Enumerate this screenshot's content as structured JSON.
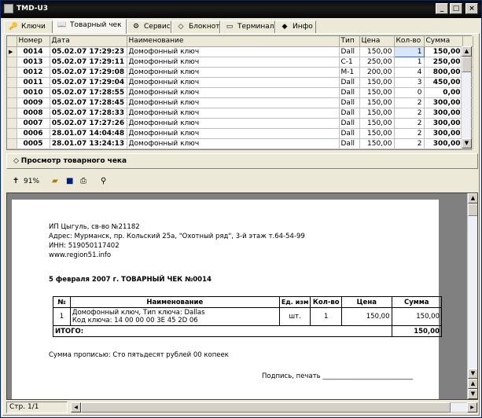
{
  "window": {
    "title": "TMD-U3"
  },
  "tabs": [
    {
      "label": "Ключи",
      "icon": "key-icon"
    },
    {
      "label": "Товарный чек",
      "icon": "book-icon"
    },
    {
      "label": "Сервис",
      "icon": "service-icon"
    },
    {
      "label": "Блокнот",
      "icon": "notepad-icon"
    },
    {
      "label": "Терминал",
      "icon": "terminal-icon"
    },
    {
      "label": "Инфо",
      "icon": "info-icon"
    }
  ],
  "grid": {
    "columns": [
      "Номер",
      "Дата",
      "Наименование",
      "Тип",
      "Цена",
      "Кол-во",
      "Сумма"
    ],
    "rows": [
      [
        "0014",
        "05.02.07 17:29:23",
        "Домофонный ключ",
        "Dall",
        "150,00",
        "1",
        "150,00"
      ],
      [
        "0013",
        "05.02.07 17:29:11",
        "Домофонный ключ",
        "C-1",
        "250,00",
        "1",
        "250,00"
      ],
      [
        "0012",
        "05.02.07 17:29:08",
        "Домофонный ключ",
        "M-1",
        "200,00",
        "4",
        "800,00"
      ],
      [
        "0011",
        "05.02.07 17:29:04",
        "Домофонный ключ",
        "Dall",
        "150,00",
        "3",
        "450,00"
      ],
      [
        "0010",
        "05.02.07 17:28:55",
        "Домофонный ключ",
        "Dall",
        "150,00",
        "0",
        "0,00"
      ],
      [
        "0009",
        "05.02.07 17:28:45",
        "Домофонный ключ",
        "Dall",
        "150,00",
        "2",
        "300,00"
      ],
      [
        "0008",
        "05.02.07 17:28:33",
        "Домофонный ключ",
        "Dall",
        "150,00",
        "2",
        "300,00"
      ],
      [
        "0007",
        "05.02.07 17:27:26",
        "Домофонный ключ",
        "Dall",
        "150,00",
        "2",
        "300,00"
      ],
      [
        "0006",
        "28.01.07 14:04:48",
        "Домофонный ключ",
        "Dall",
        "150,00",
        "2",
        "300,00"
      ],
      [
        "0005",
        "28.01.07 13:24:13",
        "Домофонный ключ",
        "Dall",
        "150,00",
        "2",
        "300,00"
      ]
    ]
  },
  "view_button": "Просмотр товарного чека",
  "toolbar": {
    "zoom": "91%"
  },
  "receipt": {
    "line1": "ИП Цыгуль, св-во №21182",
    "line2": "Адрес: Мурманск, пр. Кольский 25а, \"Охотный ряд\", 3-й этаж  т.64-54-99",
    "line3": "ИНН: 519050117402",
    "line4": "www.region51.info",
    "heading": "5 февраля 2007 г.  ТОВАРНЫЙ ЧЕК №0014",
    "col_no": "№",
    "col_name": "Наименование",
    "col_unit": "Ед. изм",
    "col_qty": "Кол-во",
    "col_price": "Цена",
    "col_sum": "Сумма",
    "item_no": "1",
    "item_name": "Домофонный ключ, Тип ключа: Dallas",
    "item_code": "Код ключа: 14 00 00 00 3E 45 2D 06",
    "item_unit": "шт.",
    "item_qty": "1",
    "item_price": "150,00",
    "item_sum": "150,00",
    "total_label": "ИТОГО:",
    "total_sum": "150,00",
    "words": "Сумма прописью: Сто пятьдесят рублей 00 копеек",
    "sign": "Подпись, печать ___________________________"
  },
  "status": "Стр. 1/1"
}
